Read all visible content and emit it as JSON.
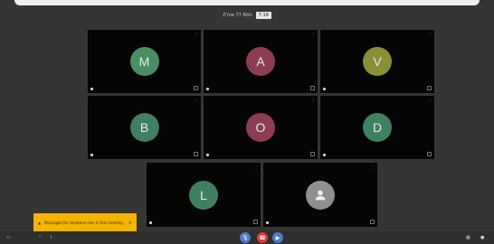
{
  "meeting": {
    "header_text": "Z'me 77 Bitri",
    "badge_text": "7:18"
  },
  "participants": [
    {
      "initial": "M",
      "color": "#4a8f64"
    },
    {
      "initial": "A",
      "color": "#8c3d52"
    },
    {
      "initial": "V",
      "color": "#8a8f38"
    },
    {
      "initial": "B",
      "color": "#3e8060"
    },
    {
      "initial": "O",
      "color": "#8c3d52"
    },
    {
      "initial": "D",
      "color": "#3e8060"
    },
    {
      "initial": "L",
      "color": "#3e8060"
    },
    {
      "initial": "",
      "color": "#8f8f8f"
    }
  ],
  "toast": {
    "message": "Messages for someone else in this meeting",
    "close_icon": "close-icon"
  },
  "controls": {
    "mic_icon": "mic-icon",
    "end_call_icon": "phone-end-icon",
    "camera_icon": "camera-icon"
  },
  "colors": {
    "background": "#353535",
    "end_call": "#e53935",
    "toolbar_blue": "#4f79c9",
    "toast": "#f5b400"
  }
}
